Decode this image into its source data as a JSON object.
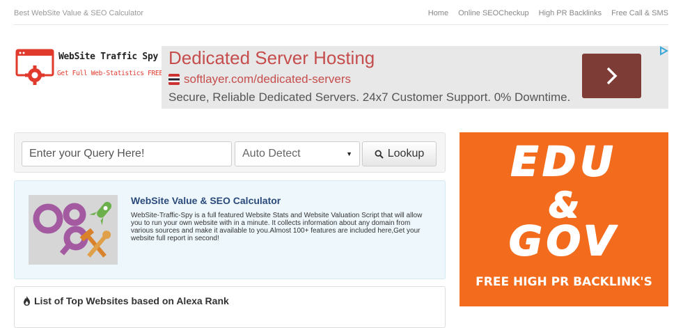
{
  "header": {
    "brand": "Best WebSite Value & SEO Calculator",
    "nav": [
      "Home",
      "Online SEOCheckup",
      "High PR Backlinks",
      "Free Call & SMS"
    ]
  },
  "logo": {
    "title": "WebSite Traffic Spy",
    "subtitle": "Get Full Web-Statistics FREE",
    "accent_color": "#e03a2d"
  },
  "ad_top": {
    "title": "Dedicated Server Hosting",
    "url": "softlayer.com/dedicated-servers",
    "description": "Secure, Reliable Dedicated Servers. 24x7 Customer Support. 0% Downtime.",
    "arrow_icon": "chevron-right-icon",
    "choice_icon": "adchoices-icon",
    "title_color": "#c64d4d",
    "button_color": "#7e3c36"
  },
  "search": {
    "placeholder": "Enter your Query Here!",
    "select_value": "Auto Detect",
    "button_label": "Lookup",
    "button_icon": "search-icon"
  },
  "info": {
    "title": "WebSite Value & SEO Calculator",
    "text": "WebSite-Traffic-Spy is a full featured Website Stats and Website Valuation Script that will allow you to run your own website with in a minute. It collects information about any domain from various sources and make it available to you.Almost 100+ features are included here,Get your website full report in second!",
    "title_color": "#2a4a7c"
  },
  "top_sites": {
    "icon": "fire-icon",
    "title": "List of Top Websites based on Alexa Rank"
  },
  "ad_side": {
    "line1": "EDU",
    "line2": "&",
    "line3": "GOV",
    "tagline": "FREE HIGH PR BACKLINK'S",
    "bg_color": "#f36c1e"
  }
}
